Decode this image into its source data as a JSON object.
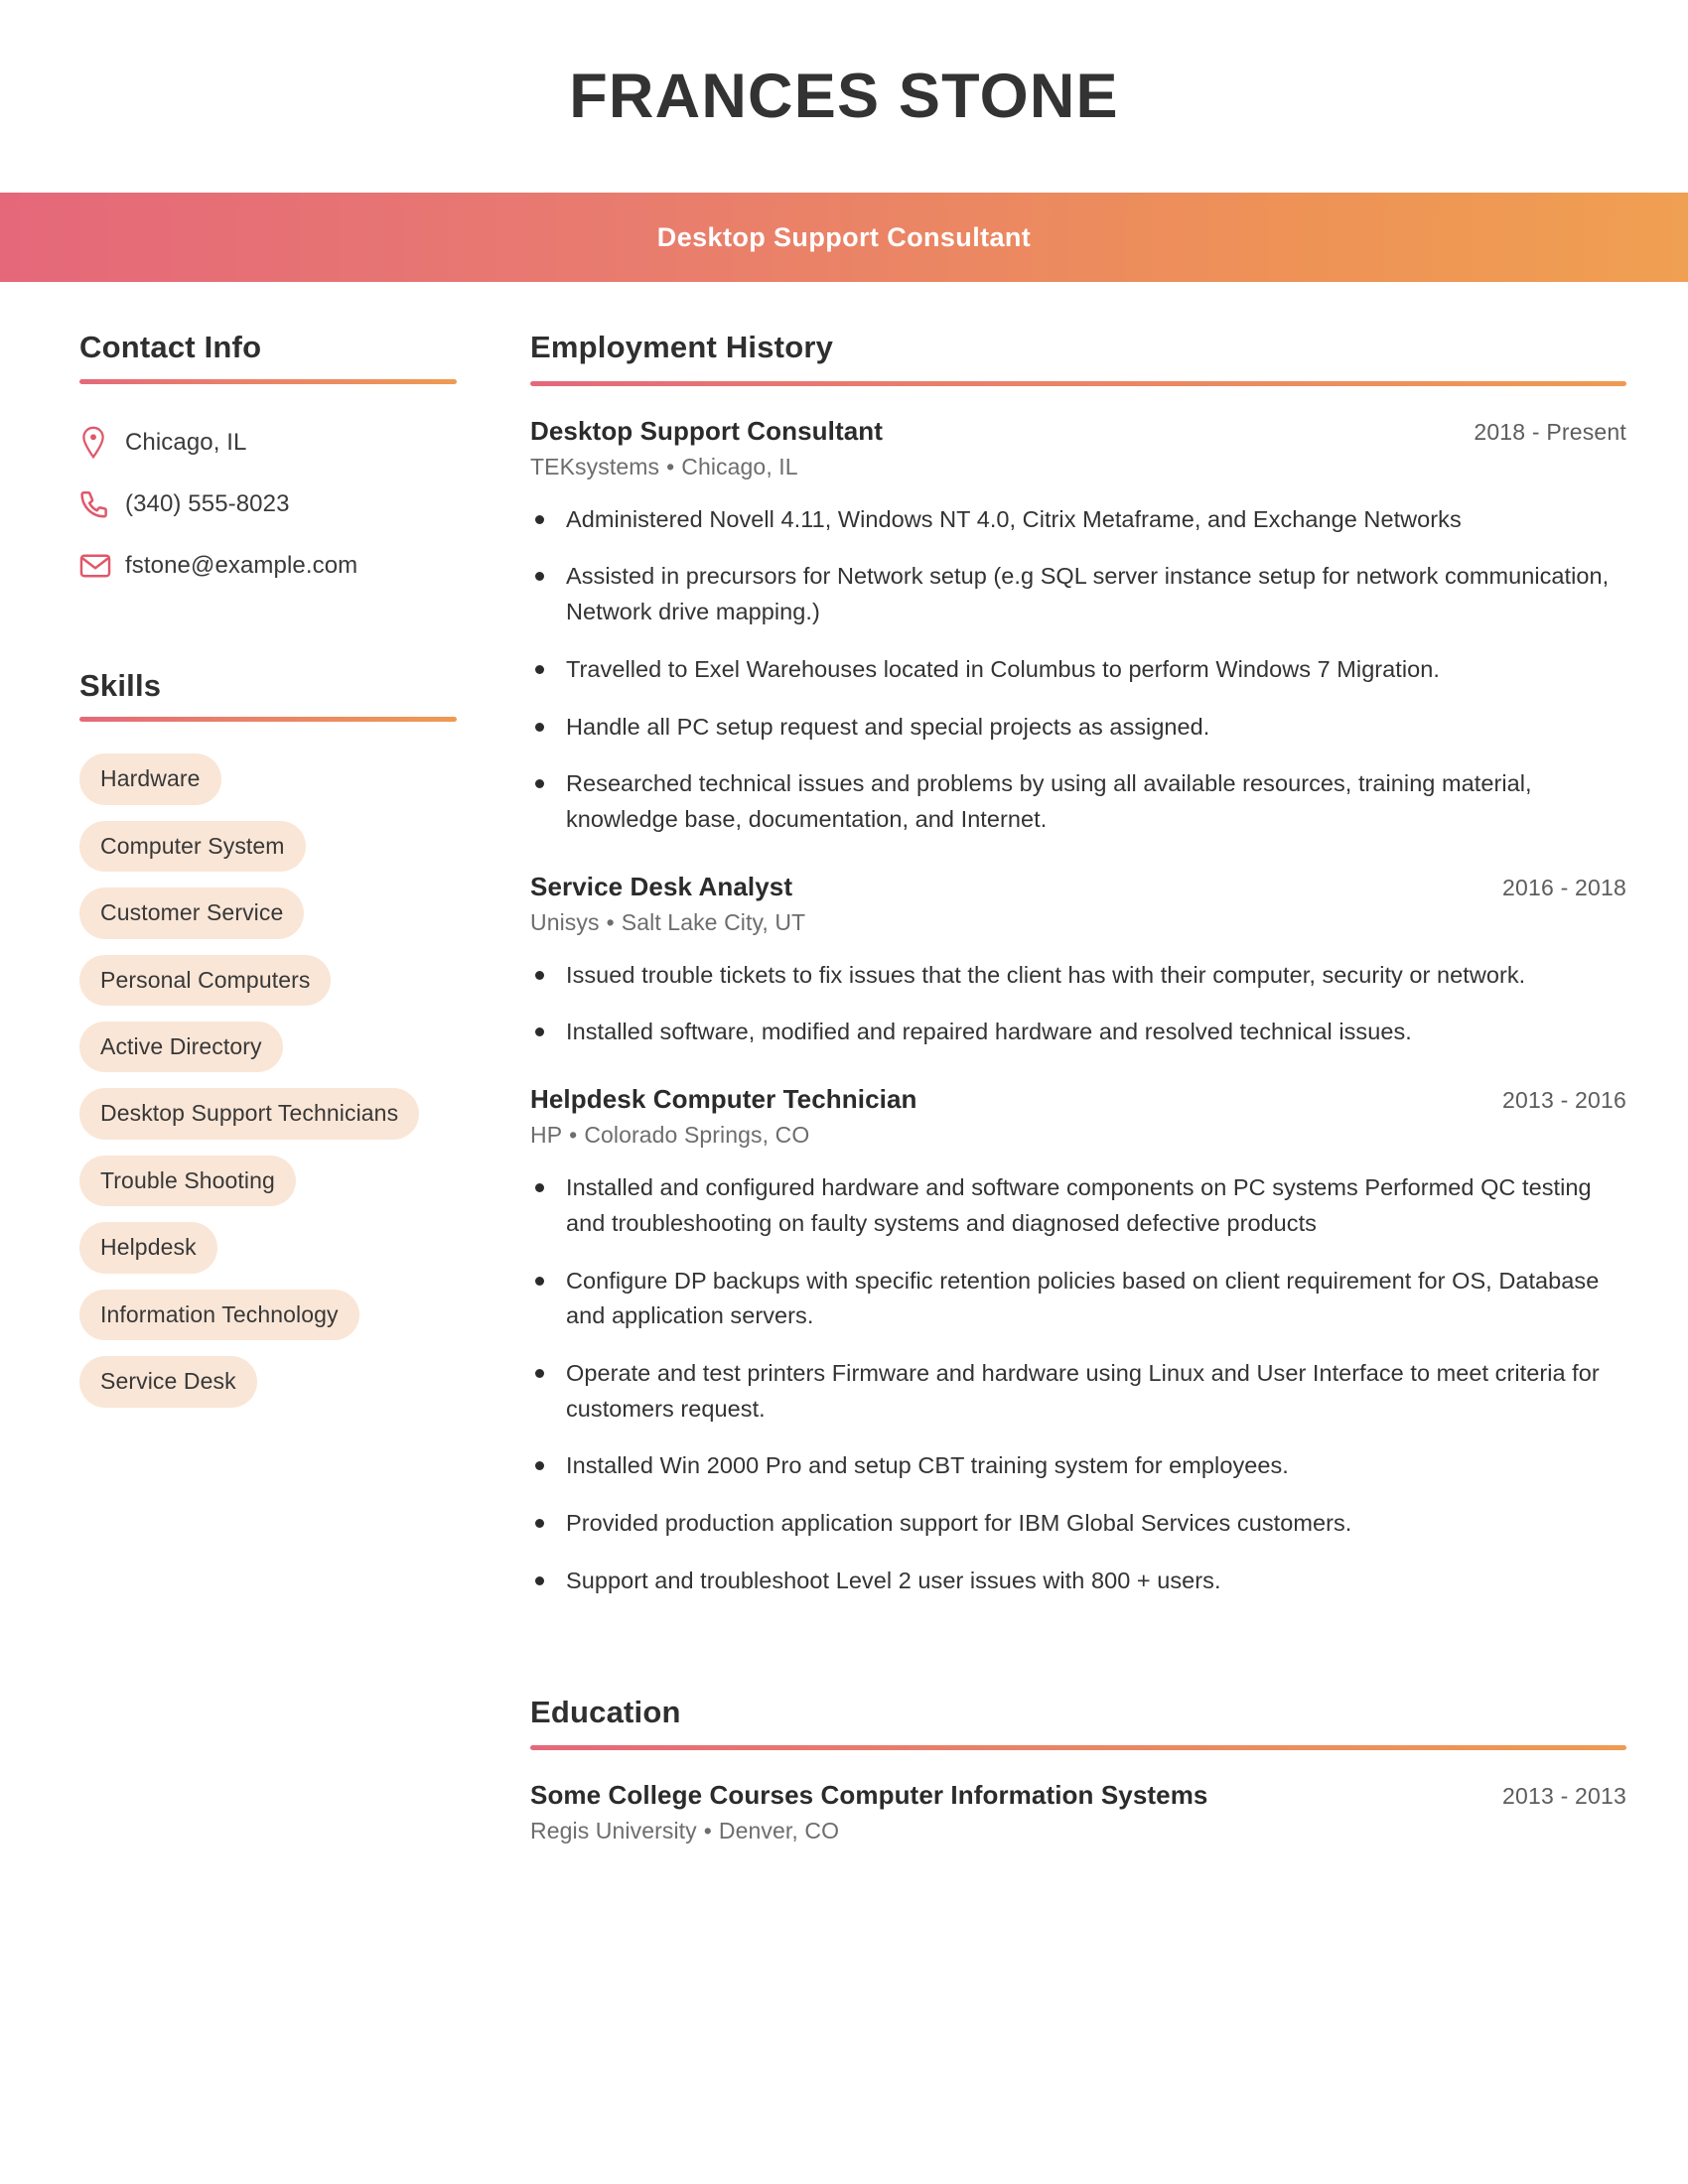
{
  "header": {
    "name": "FRANCES STONE",
    "title": "Desktop Support Consultant",
    "gradient_start": "#e5687a",
    "gradient_end": "#f0a052"
  },
  "sidebar": {
    "contact": {
      "heading": "Contact Info",
      "items": [
        {
          "icon": "location-pin-icon",
          "value": "Chicago, IL"
        },
        {
          "icon": "phone-icon",
          "value": "(340) 555-8023"
        },
        {
          "icon": "envelope-icon",
          "value": "fstone@example.com"
        }
      ]
    },
    "skills": {
      "heading": "Skills",
      "pill_bg": "#fae6d6",
      "items": [
        "Hardware",
        "Computer System",
        "Customer Service",
        "Personal Computers",
        "Active Directory",
        "Desktop Support Technicians",
        "Trouble Shooting",
        "Helpdesk",
        "Information Technology",
        "Service Desk"
      ]
    }
  },
  "main": {
    "employment": {
      "heading": "Employment History",
      "entries": [
        {
          "role": "Desktop Support Consultant",
          "dates": "2018 - Present",
          "company": "TEKsystems",
          "location": "Chicago, IL",
          "bullets": [
            "Administered Novell 4.11, Windows NT 4.0, Citrix Metaframe, and Exchange Networks",
            "Assisted in precursors for Network setup (e.g SQL server instance setup for network communication, Network drive mapping.)",
            "Travelled to Exel Warehouses located in Columbus to perform Windows 7 Migration.",
            "Handle all PC setup request and special projects as assigned.",
            "Researched technical issues and problems by using all available resources, training material, knowledge base, documentation, and Internet."
          ]
        },
        {
          "role": "Service Desk Analyst",
          "dates": "2016 - 2018",
          "company": "Unisys",
          "location": "Salt Lake City, UT",
          "bullets": [
            "Issued trouble tickets to fix issues that the client has with their computer, security or network.",
            "Installed software, modified and repaired hardware and resolved technical issues."
          ]
        },
        {
          "role": "Helpdesk Computer Technician",
          "dates": "2013 - 2016",
          "company": "HP",
          "location": "Colorado Springs, CO",
          "bullets": [
            "Installed and configured hardware and software components on PC systems Performed QC testing and troubleshooting on faulty systems and diagnosed defective products",
            "Configure DP backups with specific retention policies based on client requirement for OS, Database and application servers.",
            "Operate and test printers Firmware and hardware using Linux and User Interface to meet criteria for customers request.",
            "Installed Win 2000 Pro and setup CBT training system for employees.",
            "Provided production application support for IBM Global Services customers.",
            "Support and troubleshoot Level 2 user issues with 800 + users."
          ]
        }
      ]
    },
    "education": {
      "heading": "Education",
      "entries": [
        {
          "role": "Some College Courses Computer Information Systems",
          "dates": "2013 - 2013",
          "company": "Regis University",
          "location": "Denver, CO"
        }
      ]
    }
  }
}
